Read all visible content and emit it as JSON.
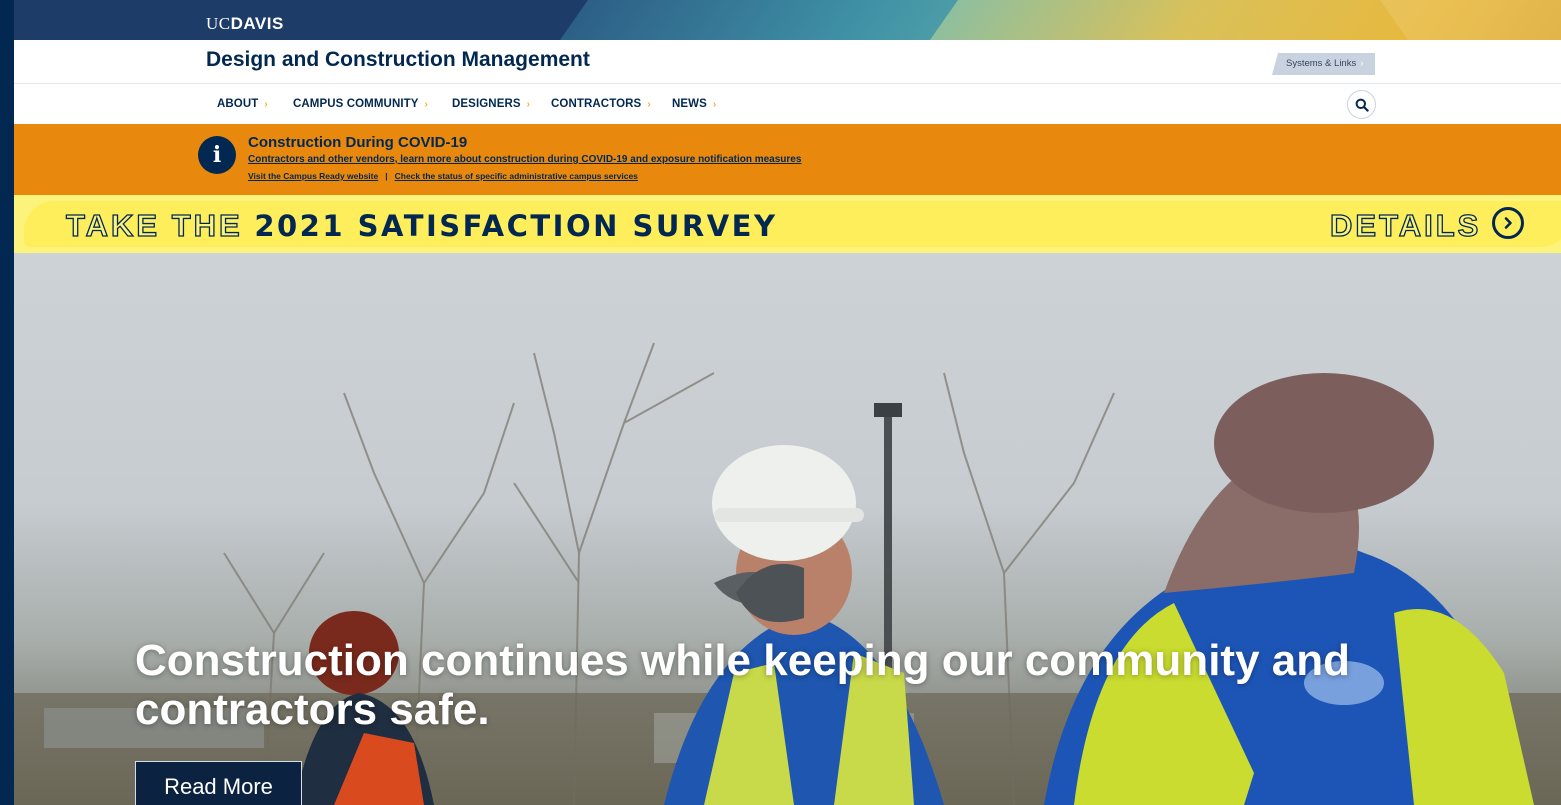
{
  "uc_bar": {
    "logo_uc": "UC",
    "logo_davis": "DAVIS"
  },
  "header": {
    "title": "Design and Construction Management",
    "systems_links": "Systems & Links",
    "systems_chevron": "›"
  },
  "nav": {
    "items": [
      {
        "label": "ABOUT",
        "chevron": "›"
      },
      {
        "label": "CAMPUS COMMUNITY",
        "chevron": "›"
      },
      {
        "label": "DESIGNERS",
        "chevron": "›"
      },
      {
        "label": "CONTRACTORS",
        "chevron": "›"
      },
      {
        "label": "NEWS",
        "chevron": "›"
      }
    ],
    "search_icon": "search-icon"
  },
  "alert": {
    "icon": "i",
    "title": "Construction During COVID-19",
    "link1": "Contractors and other vendors, learn more about construction during COVID-19 and exposure notification measures",
    "link2": "Visit the Campus Ready website",
    "separator": "|",
    "link3": "Check the status of specific administrative campus services"
  },
  "survey": {
    "prefix": "TAKE THE ",
    "highlight": "2021 SATISFACTION SURVEY",
    "details": "DETAILS",
    "details_icon": "chevron-right-circle-icon"
  },
  "hero": {
    "headline": "Construction continues while keeping our community and contractors safe.",
    "button": "Read More"
  },
  "colors": {
    "navy": "#022851",
    "gold": "#f1b13b",
    "alert_orange": "#e8880d",
    "survey_yellow": "#fbf37c"
  }
}
